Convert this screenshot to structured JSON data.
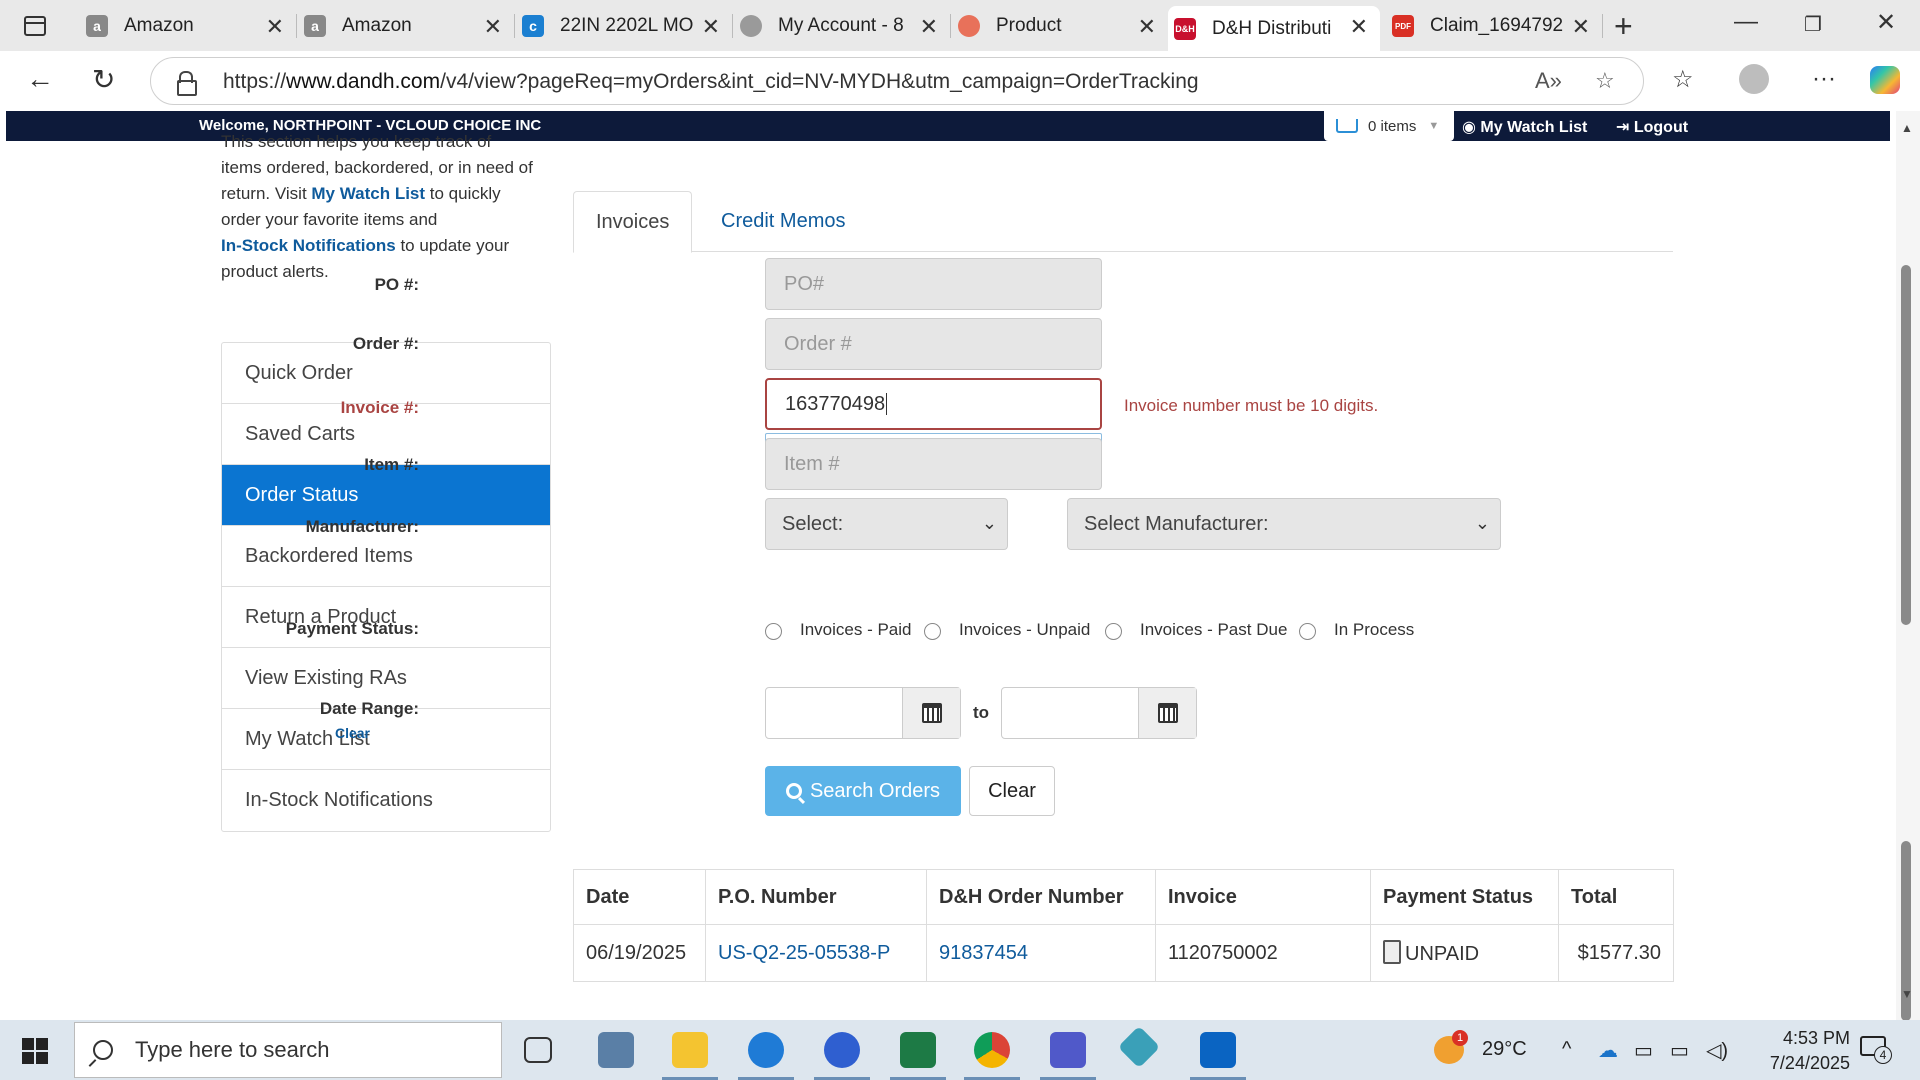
{
  "browser": {
    "tabs": [
      {
        "title": "Amazon",
        "favicon": "amazon-icon",
        "active": false
      },
      {
        "title": "Amazon",
        "favicon": "amazon-icon",
        "active": false
      },
      {
        "title": "22IN 2202L MO",
        "favicon": "product-icon",
        "active": false
      },
      {
        "title": "My Account - 8",
        "favicon": "account-icon",
        "active": false
      },
      {
        "title": "Product",
        "favicon": "product-icon",
        "active": false
      },
      {
        "title": "D&H Distributi",
        "favicon": "dh-icon",
        "active": true
      },
      {
        "title": "Claim_1694792",
        "favicon": "pdf-icon",
        "active": false
      }
    ],
    "url_prefix": "https://",
    "url_host": "www.dandh.com",
    "url_path": "/v4/view?pageReq=myOrders&int_cid=NV-MYDH&utm_campaign=OrderTracking"
  },
  "site": {
    "welcome": "Welcome, NORTHPOINT - VCLOUD CHOICE INC",
    "cart_label": "0 items",
    "watch_list_label": "My Watch List",
    "logout_label": "Logout",
    "accent_color": "#0b75d1",
    "header_color": "#0d1a3a"
  },
  "sidebar": {
    "intro_line1": "This section helps you keep track of",
    "intro_line2": "items ordered, backordered, or in need of",
    "intro_line3a": "return. Visit ",
    "intro_link1": "My Watch List",
    "intro_line3b": " to quickly",
    "intro_line4": "order your favorite items and",
    "intro_link2": "In-Stock Notifications",
    "intro_line5a": " to update your",
    "intro_line6": "product alerts.",
    "items": [
      {
        "label": "Quick Order",
        "active": false
      },
      {
        "label": "Saved Carts",
        "active": false
      },
      {
        "label": "Order Status",
        "active": true
      },
      {
        "label": "Backordered Items",
        "active": false
      },
      {
        "label": "Return a Product",
        "active": false
      },
      {
        "label": "View Existing RAs",
        "active": false
      },
      {
        "label": "My Watch List",
        "active": false
      },
      {
        "label": "In-Stock Notifications",
        "active": false
      }
    ]
  },
  "tabs": {
    "invoices": "Invoices",
    "credit_memos": "Credit Memos"
  },
  "form": {
    "po_label": "PO #:",
    "po_placeholder": "PO#",
    "order_label": "Order #:",
    "order_placeholder": "Order #",
    "invoice_label": "Invoice #:",
    "invoice_value": "163770498",
    "invoice_error": "Invoice number must be 10 digits.",
    "item_label": "Item #:",
    "item_placeholder": "Item #",
    "manufacturer_label": "Manufacturer:",
    "manufacturer_select": "Select:",
    "manufacturer_select2": "Select Manufacturer:",
    "payment_label": "Payment Status:",
    "payment_options": [
      "Invoices - Paid",
      "Invoices - Unpaid",
      "Invoices - Past Due",
      "In Process"
    ],
    "date_label": "Date Range:",
    "date_clear": "Clear",
    "to_label": "to",
    "search_button": "Search Orders",
    "clear_button": "Clear"
  },
  "table": {
    "headers": [
      "Date",
      "P.O. Number",
      "D&H Order Number",
      "Invoice",
      "Payment Status",
      "Total"
    ],
    "rows": [
      {
        "date": "06/19/2025",
        "po": "US-Q2-25-05538-P",
        "order": "91837454",
        "invoice": "1120750002",
        "status": "UNPAID",
        "total": "$1577.30"
      }
    ]
  },
  "taskbar": {
    "search_placeholder": "Type here to search",
    "temperature": "29°C",
    "weather_badge": "1",
    "time": "4:53 PM",
    "date": "7/24/2025",
    "notification_count": "4"
  }
}
